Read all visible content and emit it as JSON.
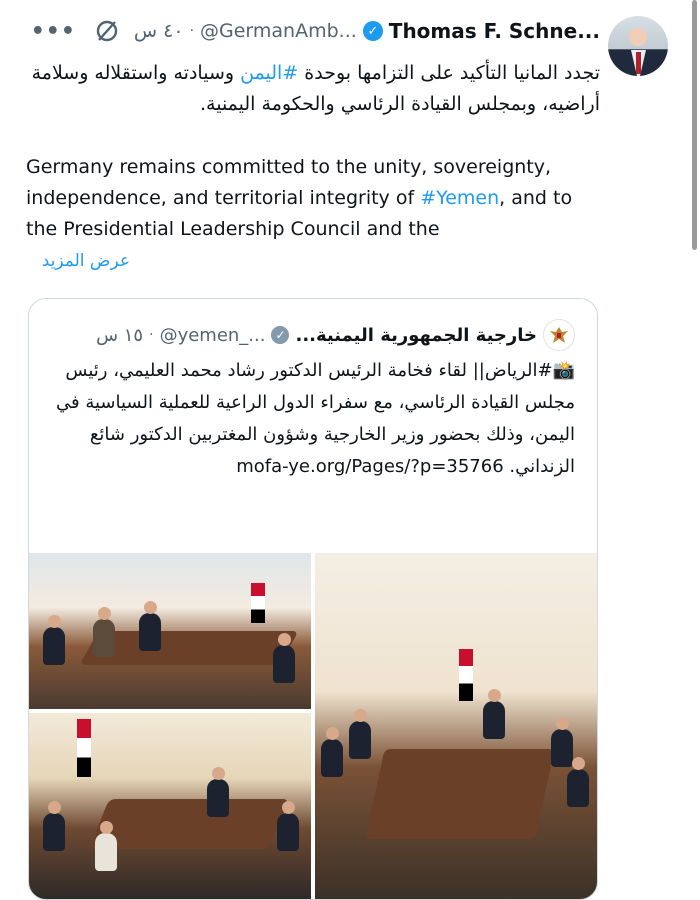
{
  "tweet": {
    "author_name": "Thomas F. Schne...",
    "handle": "@GermanAmb...",
    "time": "٤٠ س",
    "more_label": "•••",
    "arabic_text_prefix": "تجدد المانيا التأكيد على التزامها بوحدة ",
    "arabic_hashtag": "#اليمن",
    "arabic_text_suffix": " وسيادته واستقلاله وسلامة أراضيه، وبمجلس القيادة الرئاسي والحكومة اليمنية.",
    "english_text_prefix": "Germany remains committed to the unity, sovereignty, independence, and territorial integrity of ",
    "english_hashtag": "#Yemen",
    "english_text_suffix": ", and to the Presidential Leadership Council and the",
    "show_more": "عرض المزيد",
    "accent_color": "#1d9bf0"
  },
  "quoted": {
    "author_name": "خارجية الجمهورية اليمنية...",
    "handle": "@yemen_...",
    "time": "١٥ س",
    "text": "📸#الرياض|| لقاء فخامة الرئيس الدكتور رشاد محمد العليمي، رئيس مجلس القيادة الرئاسي، مع سفراء الدول الراعية للعملية السياسية في اليمن، وذلك بحضور وزير الخارجية وشؤون المغتربين الدكتور شائع الزنداني. mofa-ye.org/Pages/?p=35766"
  }
}
